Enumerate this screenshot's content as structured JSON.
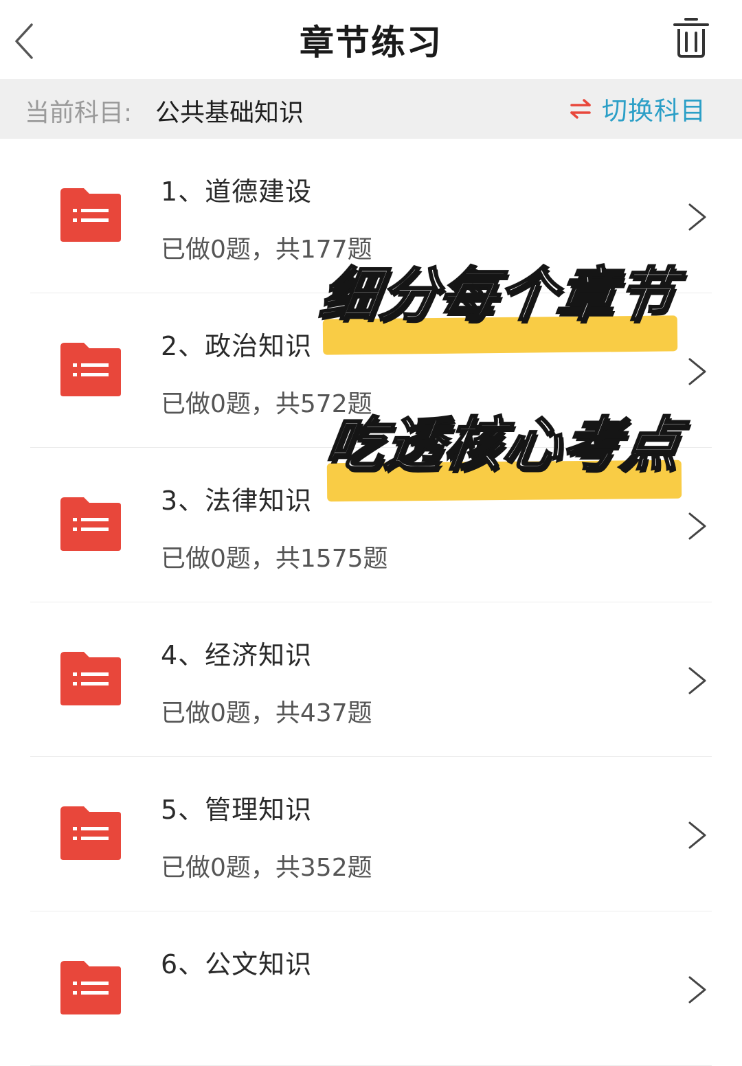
{
  "header": {
    "title": "章节练习",
    "back_icon": "chevron-left-icon",
    "delete_icon": "trash-icon"
  },
  "subject": {
    "label": "当前科目:",
    "value": "公共基础知识",
    "switch_label": "切换科目",
    "switch_icon": "swap-arrows-icon"
  },
  "chapters": [
    {
      "title": "1、道德建设",
      "stats": "已做0题，共177题"
    },
    {
      "title": "2、政治知识",
      "stats": "已做0题，共572题"
    },
    {
      "title": "3、法律知识",
      "stats": "已做0题，共1575题"
    },
    {
      "title": "4、经济知识",
      "stats": "已做0题，共437题"
    },
    {
      "title": "5、管理知识",
      "stats": "已做0题，共352题"
    },
    {
      "title": "6、公文知识",
      "stats": ""
    }
  ],
  "overlay": {
    "slogan_1": "细分每个章节",
    "slogan_2": "吃透核心考点"
  },
  "colors": {
    "folder": "#e8473b",
    "switch_text": "#2b9fc7",
    "switch_icon": "#e8473b",
    "highlight": "#f9cc45",
    "subject_bar": "#efefef"
  }
}
